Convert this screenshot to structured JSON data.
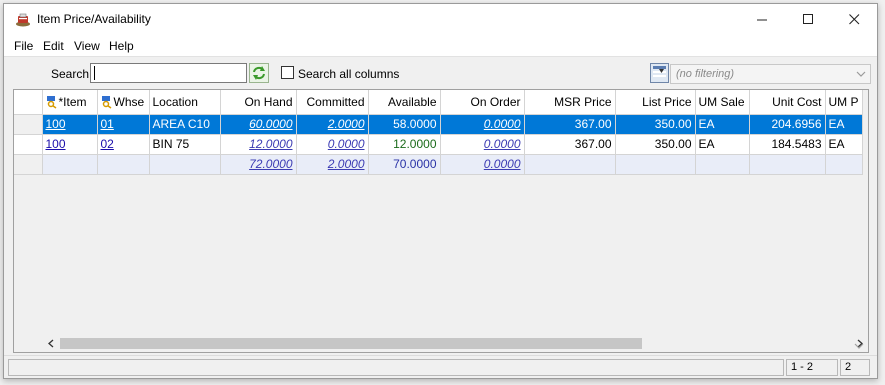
{
  "window": {
    "title": "Item Price/Availability",
    "controls": {
      "minimize": "minimize-icon",
      "maximize": "maximize-icon",
      "close": "close-icon"
    }
  },
  "menu": [
    "File",
    "Edit",
    "View",
    "Help"
  ],
  "toolbar": {
    "search_label": "Search:",
    "search_value": "",
    "search_all_label": "Search all columns",
    "search_all_checked": false,
    "filter_value": "(no filtering)"
  },
  "grid": {
    "columns": [
      "*Item",
      "Whse",
      "Location",
      "On Hand",
      "Committed",
      "Available",
      "On Order",
      "MSR Price",
      "List Price",
      "UM Sale",
      "Unit Cost",
      "UM P"
    ],
    "rows": [
      {
        "item": "100",
        "whse": "01",
        "location": "AREA C10",
        "on_hand": "60.0000",
        "committed": "2.0000",
        "available": "58.0000",
        "on_order": "0.0000",
        "msr_price": "367.00",
        "list_price": "350.00",
        "um_sale": "EA",
        "unit_cost": "204.6956",
        "um_p": "EA",
        "selected": true
      },
      {
        "item": "100",
        "whse": "02",
        "location": "BIN 75",
        "on_hand": "12.0000",
        "committed": "0.0000",
        "available": "12.0000",
        "on_order": "0.0000",
        "msr_price": "367.00",
        "list_price": "350.00",
        "um_sale": "EA",
        "unit_cost": "184.5483",
        "um_p": "EA",
        "selected": false
      }
    ],
    "totals": {
      "on_hand": "72.0000",
      "committed": "2.0000",
      "available": "70.0000",
      "on_order": "0.0000"
    }
  },
  "status": {
    "main": "",
    "range": "1 - 2",
    "count": "2"
  },
  "colors": {
    "selection": "#0078d7",
    "total_row": "#e9edf8",
    "link": "#1a0dab"
  }
}
